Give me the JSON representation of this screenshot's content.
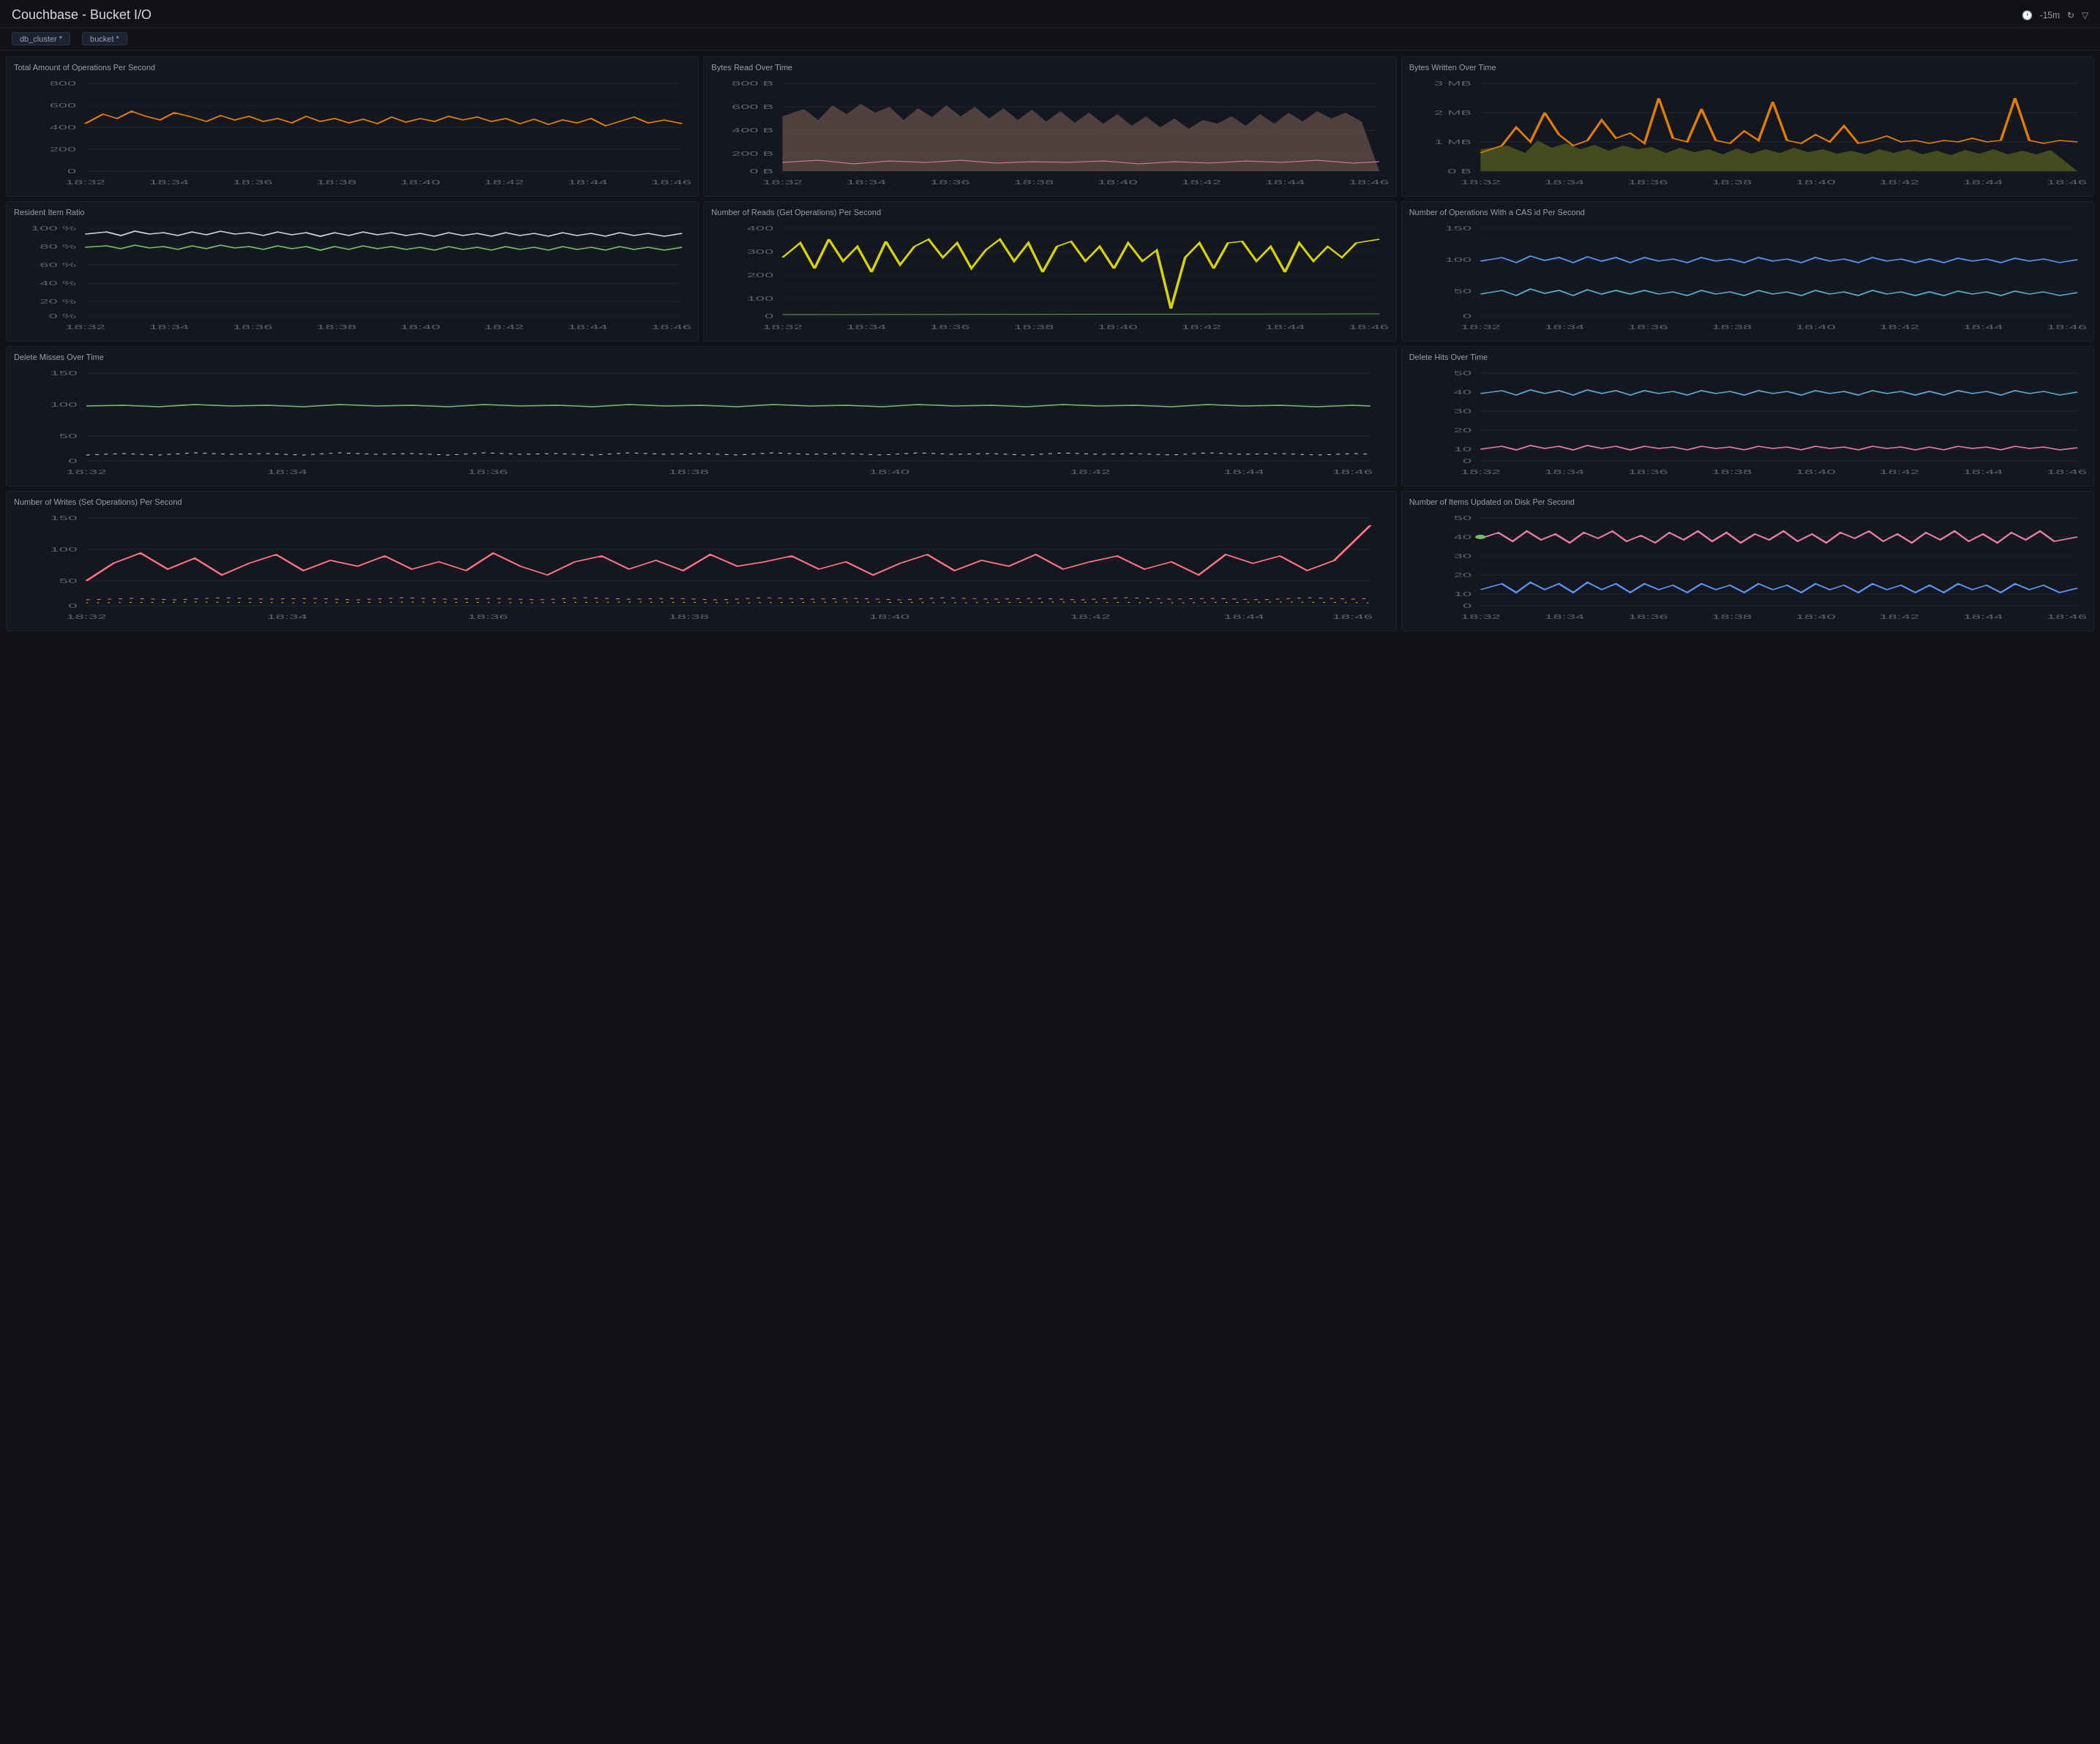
{
  "header": {
    "title": "Couchbase - Bucket I/O",
    "time_range": "-15m",
    "vars": [
      {
        "label": "db_cluster",
        "value": "*"
      },
      {
        "label": "bucket",
        "value": "*"
      }
    ]
  },
  "panels": [
    {
      "id": "total-ops",
      "title": "Total Amount of Operations Per Second",
      "col_span": 1,
      "y_max": 800,
      "y_labels": [
        "800",
        "600",
        "400",
        "200",
        "0"
      ],
      "x_labels": [
        "18:32",
        "18:34",
        "18:36",
        "18:38",
        "18:40",
        "18:42",
        "18:44",
        "18:46"
      ]
    },
    {
      "id": "bytes-read",
      "title": "Bytes Read Over Time",
      "col_span": 1,
      "y_max": "800 B",
      "y_labels": [
        "800 B",
        "600 B",
        "400 B",
        "200 B",
        "0 B"
      ],
      "x_labels": [
        "18:32",
        "18:34",
        "18:36",
        "18:38",
        "18:40",
        "18:42",
        "18:44",
        "18:46"
      ]
    },
    {
      "id": "bytes-written",
      "title": "Bytes Written Over Time",
      "col_span": 1,
      "y_max": "3 MB",
      "y_labels": [
        "3 MB",
        "2 MB",
        "1 MB",
        "0 B"
      ],
      "x_labels": [
        "18:32",
        "18:34",
        "18:36",
        "18:38",
        "18:40",
        "18:42",
        "18:44",
        "18:46"
      ]
    },
    {
      "id": "resident-ratio",
      "title": "Resident Item Ratio",
      "col_span": 1,
      "y_labels": [
        "100 %",
        "80 %",
        "60 %",
        "40 %",
        "20 %",
        "0 %"
      ],
      "x_labels": [
        "18:32",
        "18:34",
        "18:36",
        "18:38",
        "18:40",
        "18:42",
        "18:44",
        "18:46"
      ]
    },
    {
      "id": "reads-per-sec",
      "title": "Number of Reads (Get Operations) Per Second",
      "col_span": 1,
      "y_labels": [
        "400",
        "300",
        "200",
        "100",
        "0"
      ],
      "x_labels": [
        "18:32",
        "18:34",
        "18:36",
        "18:38",
        "18:40",
        "18:42",
        "18:44",
        "18:46"
      ]
    },
    {
      "id": "cas-ops",
      "title": "Number of Operations With a CAS id Per Second",
      "col_span": 1,
      "y_labels": [
        "150",
        "100",
        "50",
        "0"
      ],
      "x_labels": [
        "18:32",
        "18:34",
        "18:36",
        "18:38",
        "18:40",
        "18:42",
        "18:44",
        "18:46"
      ]
    },
    {
      "id": "delete-misses",
      "title": "Delete Misses Over Time",
      "col_span": 1,
      "y_labels": [
        "150",
        "100",
        "50",
        "0"
      ],
      "x_labels": [
        "18:32",
        "18:34",
        "18:36",
        "18:38",
        "18:40",
        "18:42",
        "18:44",
        "18:46"
      ]
    },
    {
      "id": "delete-hits",
      "title": "Delete Hits Over Time",
      "col_span": 1,
      "y_labels": [
        "50",
        "40",
        "30",
        "20",
        "10",
        "0"
      ],
      "x_labels": [
        "18:32",
        "18:34",
        "18:36",
        "18:38",
        "18:40",
        "18:42",
        "18:44",
        "18:46"
      ]
    },
    {
      "id": "writes-per-sec",
      "title": "Number of Writes (Set Operations) Per Second",
      "col_span": 1,
      "y_labels": [
        "150",
        "100",
        "50",
        "0"
      ],
      "x_labels": [
        "18:32",
        "18:34",
        "18:36",
        "18:38",
        "18:40",
        "18:42",
        "18:44",
        "18:46"
      ]
    },
    {
      "id": "items-updated-disk",
      "title": "Number of Items Updated on Disk Per Second",
      "col_span": 1,
      "y_labels": [
        "50",
        "40",
        "30",
        "20",
        "10",
        "0"
      ],
      "x_labels": [
        "18:32",
        "18:34",
        "18:36",
        "18:38",
        "18:40",
        "18:42",
        "18:44",
        "18:46"
      ]
    }
  ],
  "colors": {
    "orange": "#e07c00",
    "yellow": "#d6d400",
    "green": "#73bf69",
    "cyan": "#5794f2",
    "pink": "#e87d9e",
    "blue": "#5ba3cf",
    "white": "#ccccdc",
    "teal": "#56a64b",
    "olive": "#808000",
    "light_green": "#96d98d",
    "coral": "#ff7383",
    "purple": "#b877d9",
    "gray_green": "#56875d"
  }
}
